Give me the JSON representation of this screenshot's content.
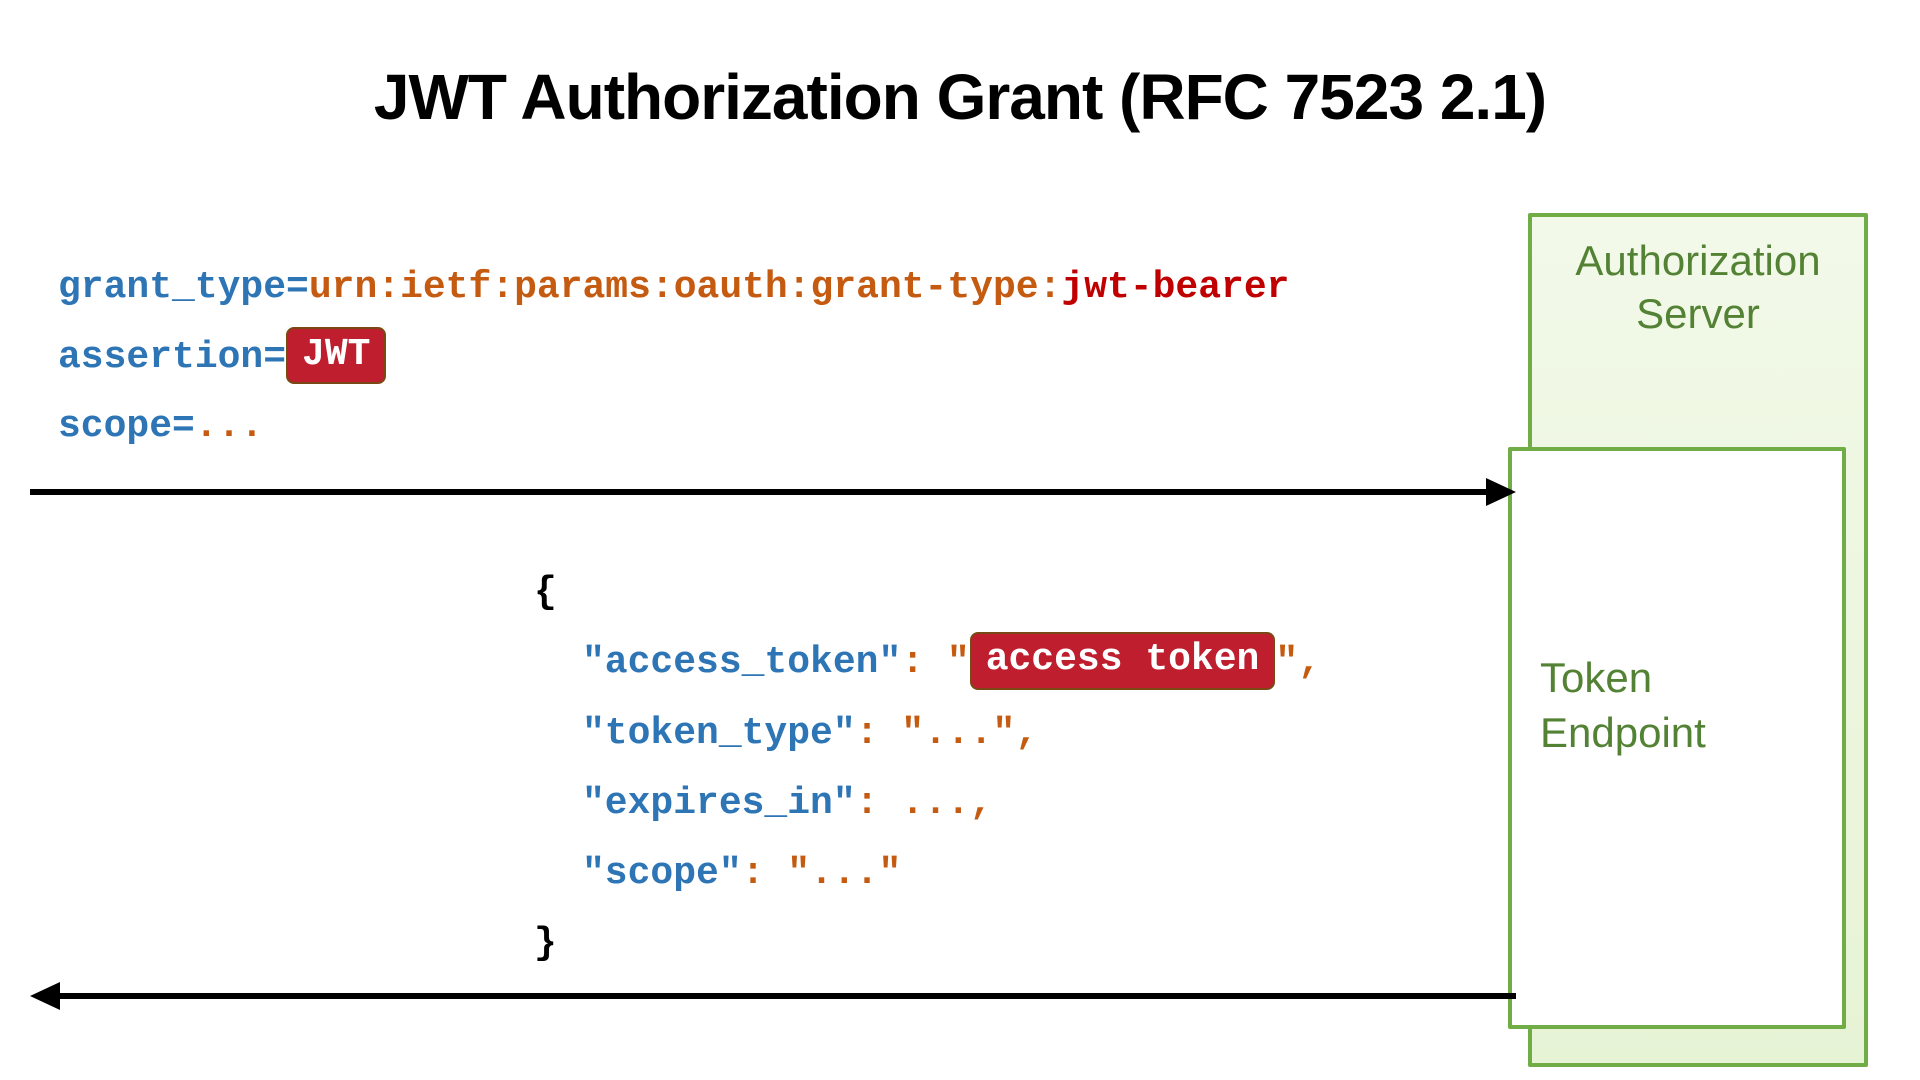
{
  "title": "JWT Authorization Grant (RFC 7523 2.1)",
  "request": {
    "grant_type_param": "grant_type",
    "grant_type_value_prefix": "urn:ietf:params:oauth:grant-type:",
    "grant_type_value_suffix": "jwt-bearer",
    "assertion_param": "assertion",
    "assertion_badge": "JWT",
    "scope_param": "scope",
    "scope_value": "..."
  },
  "response": {
    "open_brace": "{",
    "access_token_key": "\"access_token\"",
    "access_token_badge": "access token",
    "token_type_key": "\"token_type\"",
    "token_type_value": "\"...\"",
    "expires_in_key": "\"expires_in\"",
    "expires_in_value": "...",
    "scope_key": "\"scope\"",
    "scope_value": "\"...\"",
    "close_brace": "}"
  },
  "server": {
    "auth_label_line1": "Authorization",
    "auth_label_line2": "Server",
    "token_label_line1": "Token",
    "token_label_line2": "Endpoint"
  },
  "punct": {
    "eq": "=",
    "colon": ":",
    "comma": ",",
    "quote": "\""
  }
}
